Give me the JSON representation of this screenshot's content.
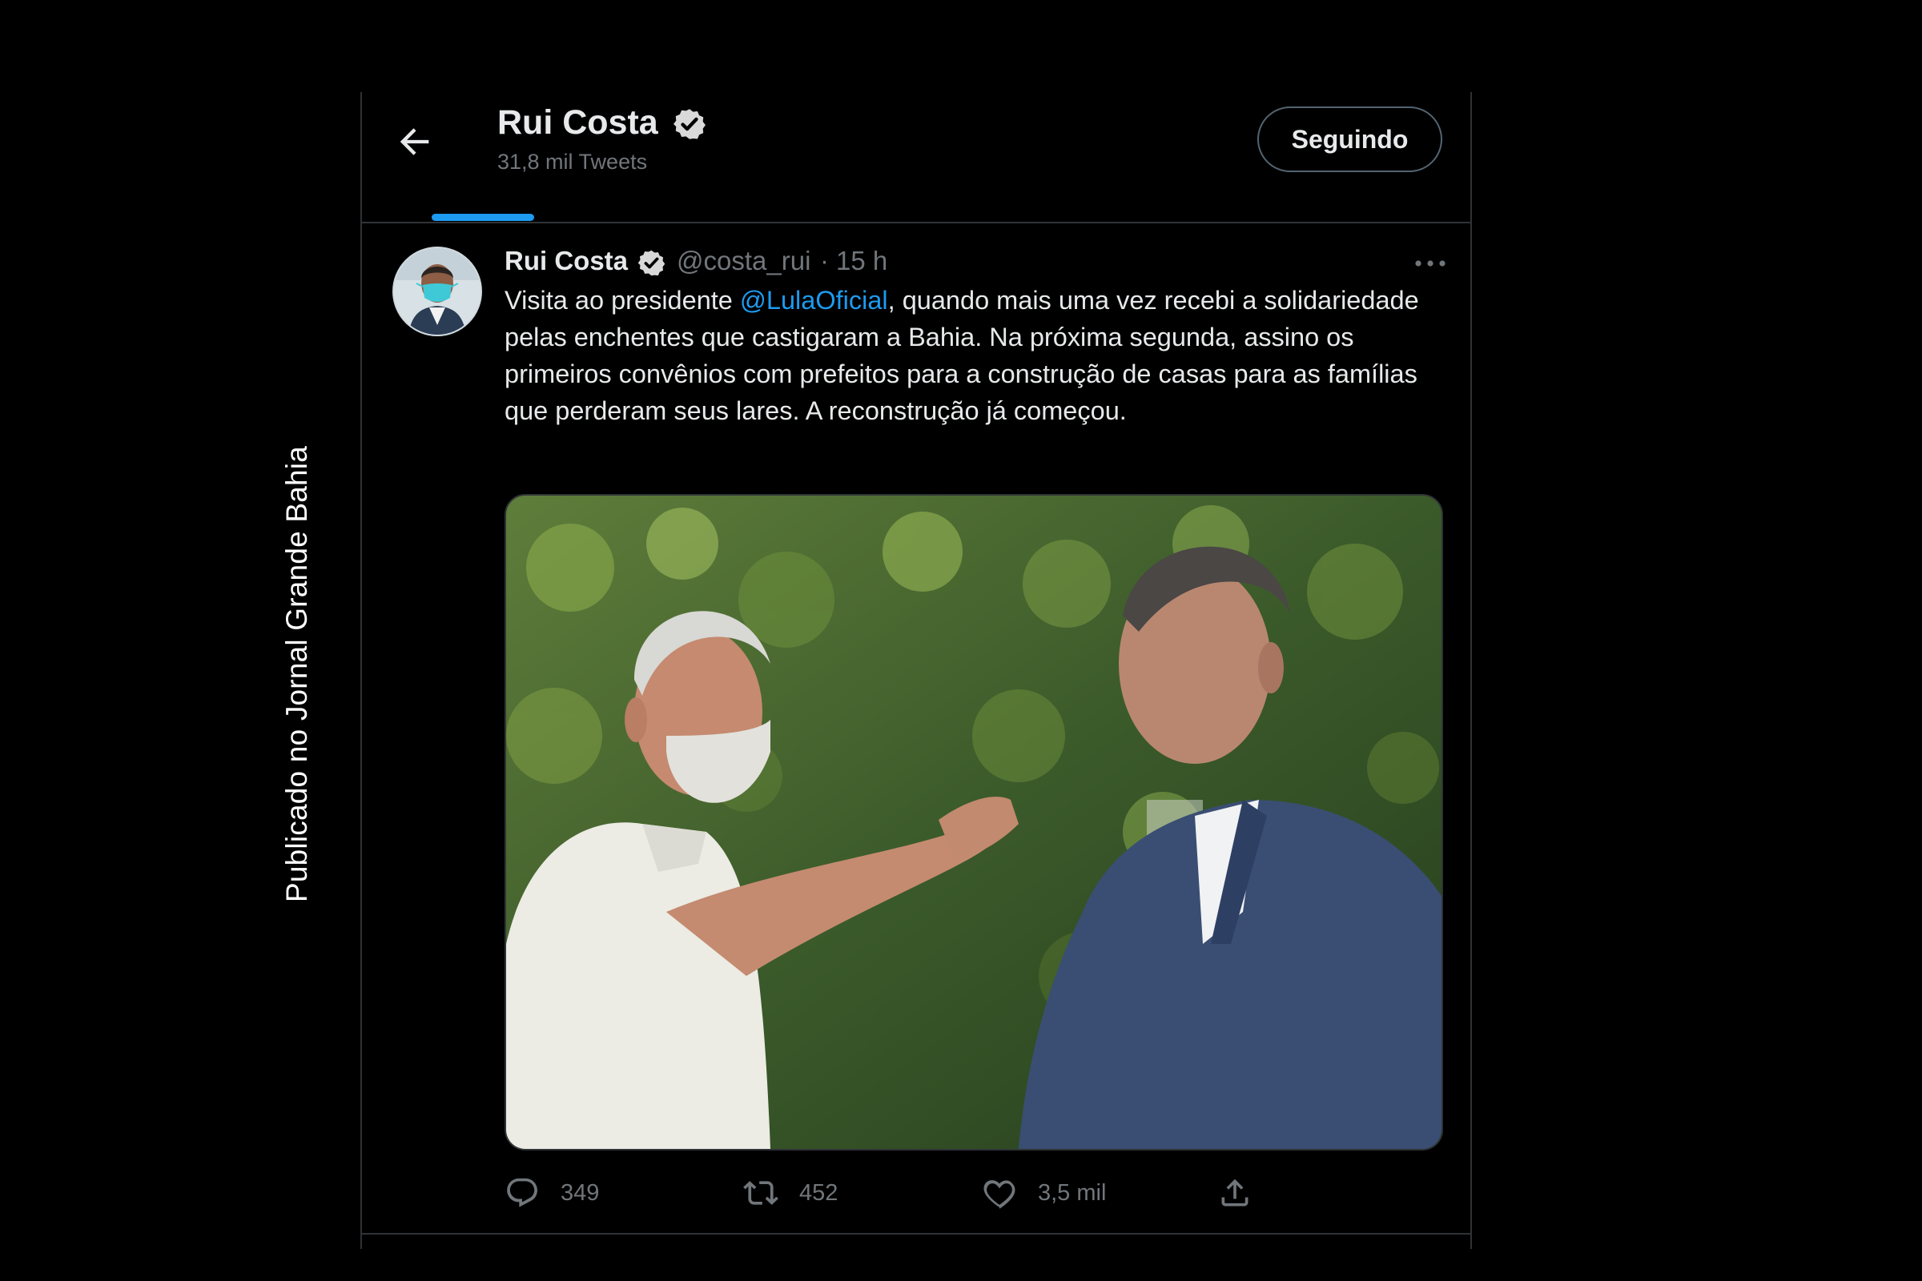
{
  "watermark": "Publicado no Jornal Grande Bahia",
  "header": {
    "name": "Rui Costa",
    "tweet_count": "31,8 mil Tweets",
    "follow_button": "Seguindo"
  },
  "tweet": {
    "author_name": "Rui Costa",
    "handle": "@costa_rui",
    "separator": "·",
    "time": "15 h",
    "text_before": "Visita ao presidente ",
    "mention": "@LulaOficial",
    "text_after": ", quando mais uma vez recebi a solidariedade pelas enchentes que castigaram a Bahia. Na próxima segunda, assino os primeiros convênios com prefeitos para a construção de casas para as famílias que perderam seus lares. A reconstrução já começou.",
    "replies": "349",
    "retweets": "452",
    "likes": "3,5 mil"
  },
  "icons": {
    "back": "arrow-left-icon",
    "verified": "verified-badge-icon",
    "more": "more-dots-icon",
    "reply": "reply-icon",
    "retweet": "retweet-icon",
    "like": "heart-icon",
    "share": "share-icon"
  },
  "colors": {
    "background": "#000000",
    "accent": "#1d9bf0",
    "secondary_text": "#71767b",
    "primary_text": "#e7e9ea"
  }
}
